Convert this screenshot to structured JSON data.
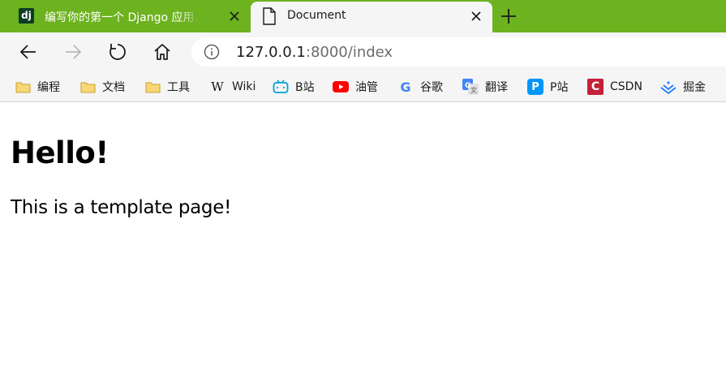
{
  "tabs": [
    {
      "title": "编写你的第一个 Django 应用，第",
      "favicon_text": "dj",
      "active": false
    },
    {
      "title": "Document",
      "active": true
    }
  ],
  "toolbar": {
    "url_host": "127.0.0.1",
    "url_rest": ":8000/index"
  },
  "bookmarks": [
    {
      "label": "编程",
      "icon": "folder-icon"
    },
    {
      "label": "文档",
      "icon": "folder-icon"
    },
    {
      "label": "工具",
      "icon": "folder-icon"
    },
    {
      "label": "Wiki",
      "icon": "wikipedia-icon",
      "glyph": "W"
    },
    {
      "label": "B站",
      "icon": "bilibili-icon"
    },
    {
      "label": "油管",
      "icon": "youtube-icon"
    },
    {
      "label": "谷歌",
      "icon": "google-icon",
      "glyph": "G"
    },
    {
      "label": "翻译",
      "icon": "translate-icon"
    },
    {
      "label": "P站",
      "icon": "pixiv-icon",
      "glyph": "P"
    },
    {
      "label": "CSDN",
      "icon": "csdn-icon",
      "glyph": "C"
    },
    {
      "label": "掘金",
      "icon": "juejin-icon"
    }
  ],
  "page": {
    "heading": "Hello!",
    "paragraph": "This is a template page!"
  },
  "colors": {
    "tabstrip": "#6db21f",
    "toolbar": "#f5f5f5",
    "youtube_red": "#ff0000",
    "bilibili_blue": "#00a1d6",
    "csdn_red": "#c32136",
    "pixiv_blue": "#0096fa",
    "juejin_blue": "#1e80ff"
  }
}
